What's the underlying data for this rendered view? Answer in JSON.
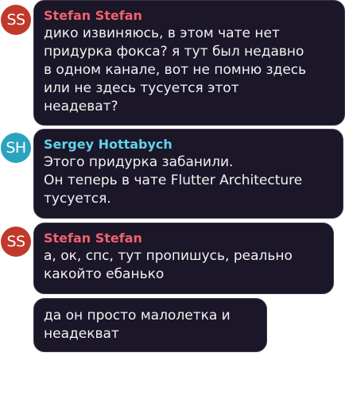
{
  "colors": {
    "stefan_avatar": "#c0392b",
    "sergey_avatar": "#2aa3bf",
    "stefan_name": "#f0616d",
    "sergey_name": "#5fd3ea",
    "bubble_bg": "#1b1628",
    "message_text": "#f2f2f2"
  },
  "messages": [
    {
      "avatar_initials": "SS",
      "sender": "Stefan Stefan",
      "text": "дико извиняюсь, в этом чате нет\nпридурка фокса? я тут был недавно\nв одном канале, вот не помню здесь\nили не здесь тусуется этот\nнеадеват?"
    },
    {
      "avatar_initials": "SH",
      "sender": "Sergey Hottabych",
      "text": "Этого придурка забанили.\nОн теперь в чате Flutter Architecture\nтусуется."
    },
    {
      "avatar_initials": "SS",
      "sender": "Stefan Stefan",
      "text": "а, ок, спс, тут пропишусь, реально\nкакойто ебанько"
    },
    {
      "text": "да он просто малолетка и\nнеадекват"
    }
  ]
}
